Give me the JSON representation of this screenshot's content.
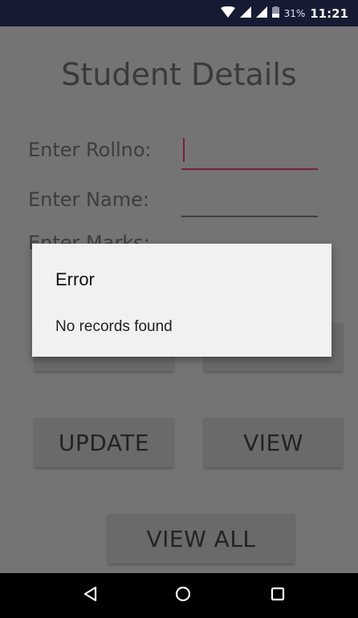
{
  "status_bar": {
    "battery_percent": "31%",
    "time": "11:21",
    "icons": [
      "wifi-icon",
      "signal-icon",
      "signal-icon",
      "battery-icon"
    ]
  },
  "app": {
    "title": "Student Details",
    "rollno_label": "Enter Rollno:",
    "rollno_value": "",
    "name_label": "Enter Name:",
    "name_value": "",
    "marks_label": "Enter Marks:",
    "buttons": {
      "update": "UPDATE",
      "view": "VIEW",
      "view_all": "VIEW ALL"
    }
  },
  "dialog": {
    "title": "Error",
    "message": "No records found"
  },
  "nav_bar": {
    "icons": [
      "back-icon",
      "home-icon",
      "recents-icon"
    ]
  },
  "colors": {
    "status_bar_bg": "#161a33",
    "accent": "#7a1f3e",
    "dialog_bg": "#f1f1f1",
    "scrim_bg": "#747474"
  }
}
